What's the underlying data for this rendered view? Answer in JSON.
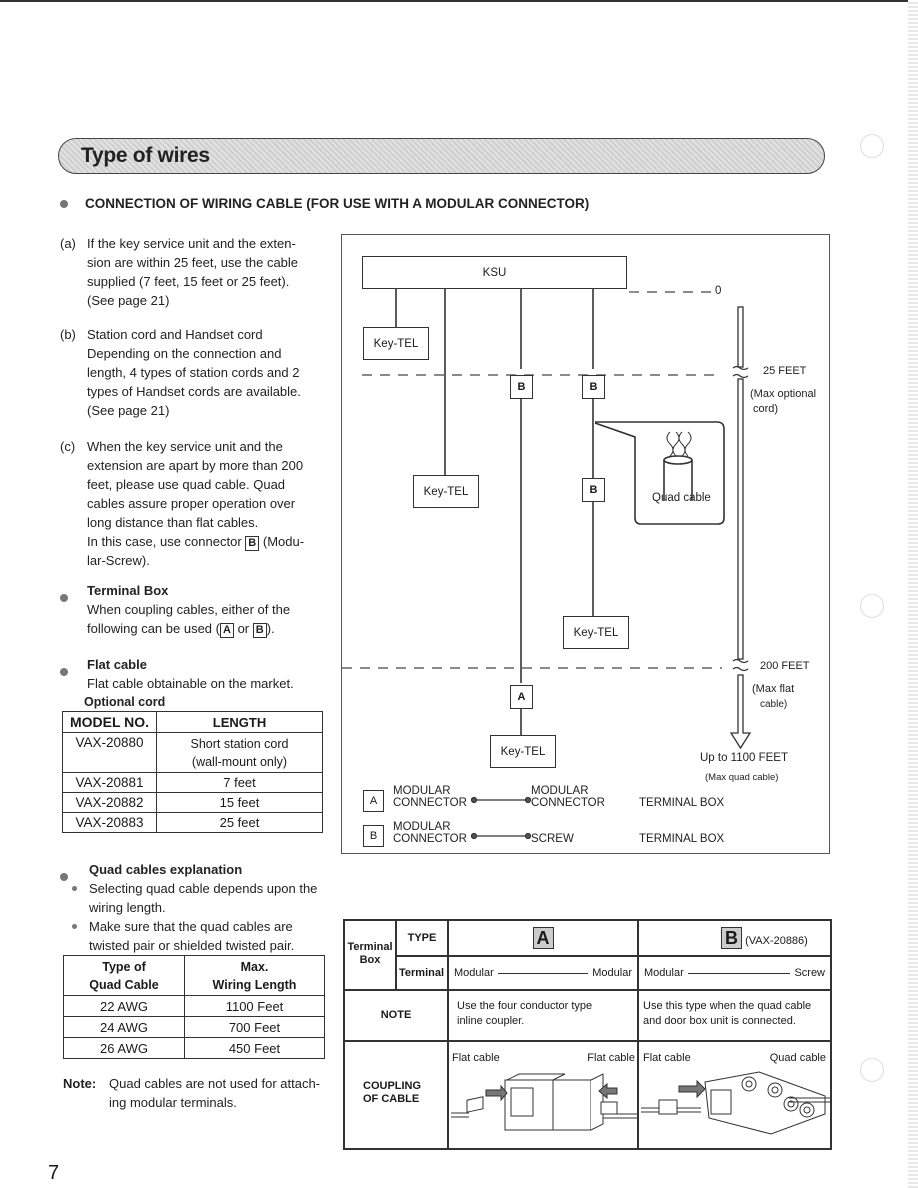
{
  "section_banner": "Type of wires",
  "section_heading": "CONNECTION OF WIRING CABLE (FOR USE WITH A MODULAR CONNECTOR)",
  "items": [
    {
      "label": "(a)",
      "lines": [
        "If the key service unit and the exten-",
        "sion are within 25 feet, use the cable",
        "supplied (7 feet, 15 feet or 25 feet).",
        "(See page 21)"
      ]
    },
    {
      "label": "(b)",
      "lines": [
        "Station cord and Handset cord",
        "Depending on the connection and",
        "length, 4 types of station cords and 2",
        "types of Handset cords are available.",
        "(See page 21)"
      ]
    },
    {
      "label": "(c)",
      "lines": [
        "When the key service unit and the",
        "extension are apart by more than 200",
        "feet, please use quad cable. Quad",
        "cables assure proper operation over",
        "long distance than flat cables."
      ],
      "line6_pre": "In this case, use connector",
      "line6_box": "B",
      "line6_post": "(Modu-",
      "line7": "lar-Screw)."
    }
  ],
  "terminal_box": {
    "title": "Terminal Box",
    "line1": "When coupling cables, either of the",
    "line2_pre": "following can be used (",
    "box_a": "A",
    "or": "or",
    "box_b": "B",
    "line2_post": ")."
  },
  "flat_cable": {
    "title": "Flat cable",
    "text": "Flat cable obtainable on the market.",
    "optional_cord": "Optional cord"
  },
  "cord_table": {
    "headers": [
      "MODEL NO.",
      "LENGTH"
    ],
    "rows": [
      [
        "VAX-20880",
        "Short station cord",
        "(wall-mount only)"
      ],
      [
        "VAX-20881",
        "7 feet"
      ],
      [
        "VAX-20882",
        "15 feet"
      ],
      [
        "VAX-20883",
        "25 feet"
      ]
    ]
  },
  "quad_explanation": {
    "title": "Quad cables explanation",
    "bullets": [
      [
        "Selecting quad cable depends upon the",
        "wiring length."
      ],
      [
        "Make sure that the quad cables are",
        "twisted pair or shielded twisted pair."
      ]
    ]
  },
  "quad_table": {
    "headers": [
      [
        "Type of",
        "Quad Cable"
      ],
      [
        "Max.",
        "Wiring Length"
      ]
    ],
    "rows": [
      [
        "22 AWG",
        "1100 Feet"
      ],
      [
        "24 AWG",
        "700 Feet"
      ],
      [
        "26 AWG",
        "450 Feet"
      ]
    ]
  },
  "note": {
    "label": "Note:",
    "lines": [
      "Quad cables are not used for attach-",
      "ing modular terminals."
    ]
  },
  "diagram": {
    "ksu": "KSU",
    "key_tel": "Key-TEL",
    "connector_b": "B",
    "connector_a": "A",
    "quad_cable": "Quad cable",
    "marker_0": "0",
    "marker_25": "25 FEET",
    "marker_25_note": [
      "(Max optional",
      "cord)"
    ],
    "marker_200": "200 FEET",
    "marker_200_note": [
      "(Max flat",
      "cable)"
    ],
    "marker_1100": "Up to 1100 FEET",
    "marker_1100_note": "(Max quad cable)",
    "legend": [
      {
        "box": "A",
        "from": [
          "MODULAR",
          "CONNECTOR"
        ],
        "to": [
          "MODULAR",
          "CONNECTOR"
        ],
        "type": "TERMINAL BOX"
      },
      {
        "box": "B",
        "from": [
          "MODULAR",
          "CONNECTOR"
        ],
        "to": [
          "SCREW"
        ],
        "type": "TERMINAL BOX"
      }
    ]
  },
  "terminal_table": {
    "terminal_box": [
      "Terminal",
      "Box"
    ],
    "type_label": "TYPE",
    "terminal_label": "Terminal",
    "type_a": "A",
    "type_b": "B",
    "type_b_model": "(VAX-20886)",
    "a_from": "Modular",
    "a_to": "Modular",
    "b_from": "Modular",
    "b_to": "Screw",
    "note_label": "NOTE",
    "note_a": [
      "Use the four conductor type",
      "inline coupler."
    ],
    "note_b": [
      "Use this type when the quad cable",
      "and door box unit is connected."
    ],
    "coupling_label": [
      "COUPLING",
      "OF CABLE"
    ],
    "a_left": "Flat cable",
    "a_right": "Flat cable",
    "b_left": "Flat cable",
    "b_right": "Quad cable"
  },
  "page_number": "7"
}
